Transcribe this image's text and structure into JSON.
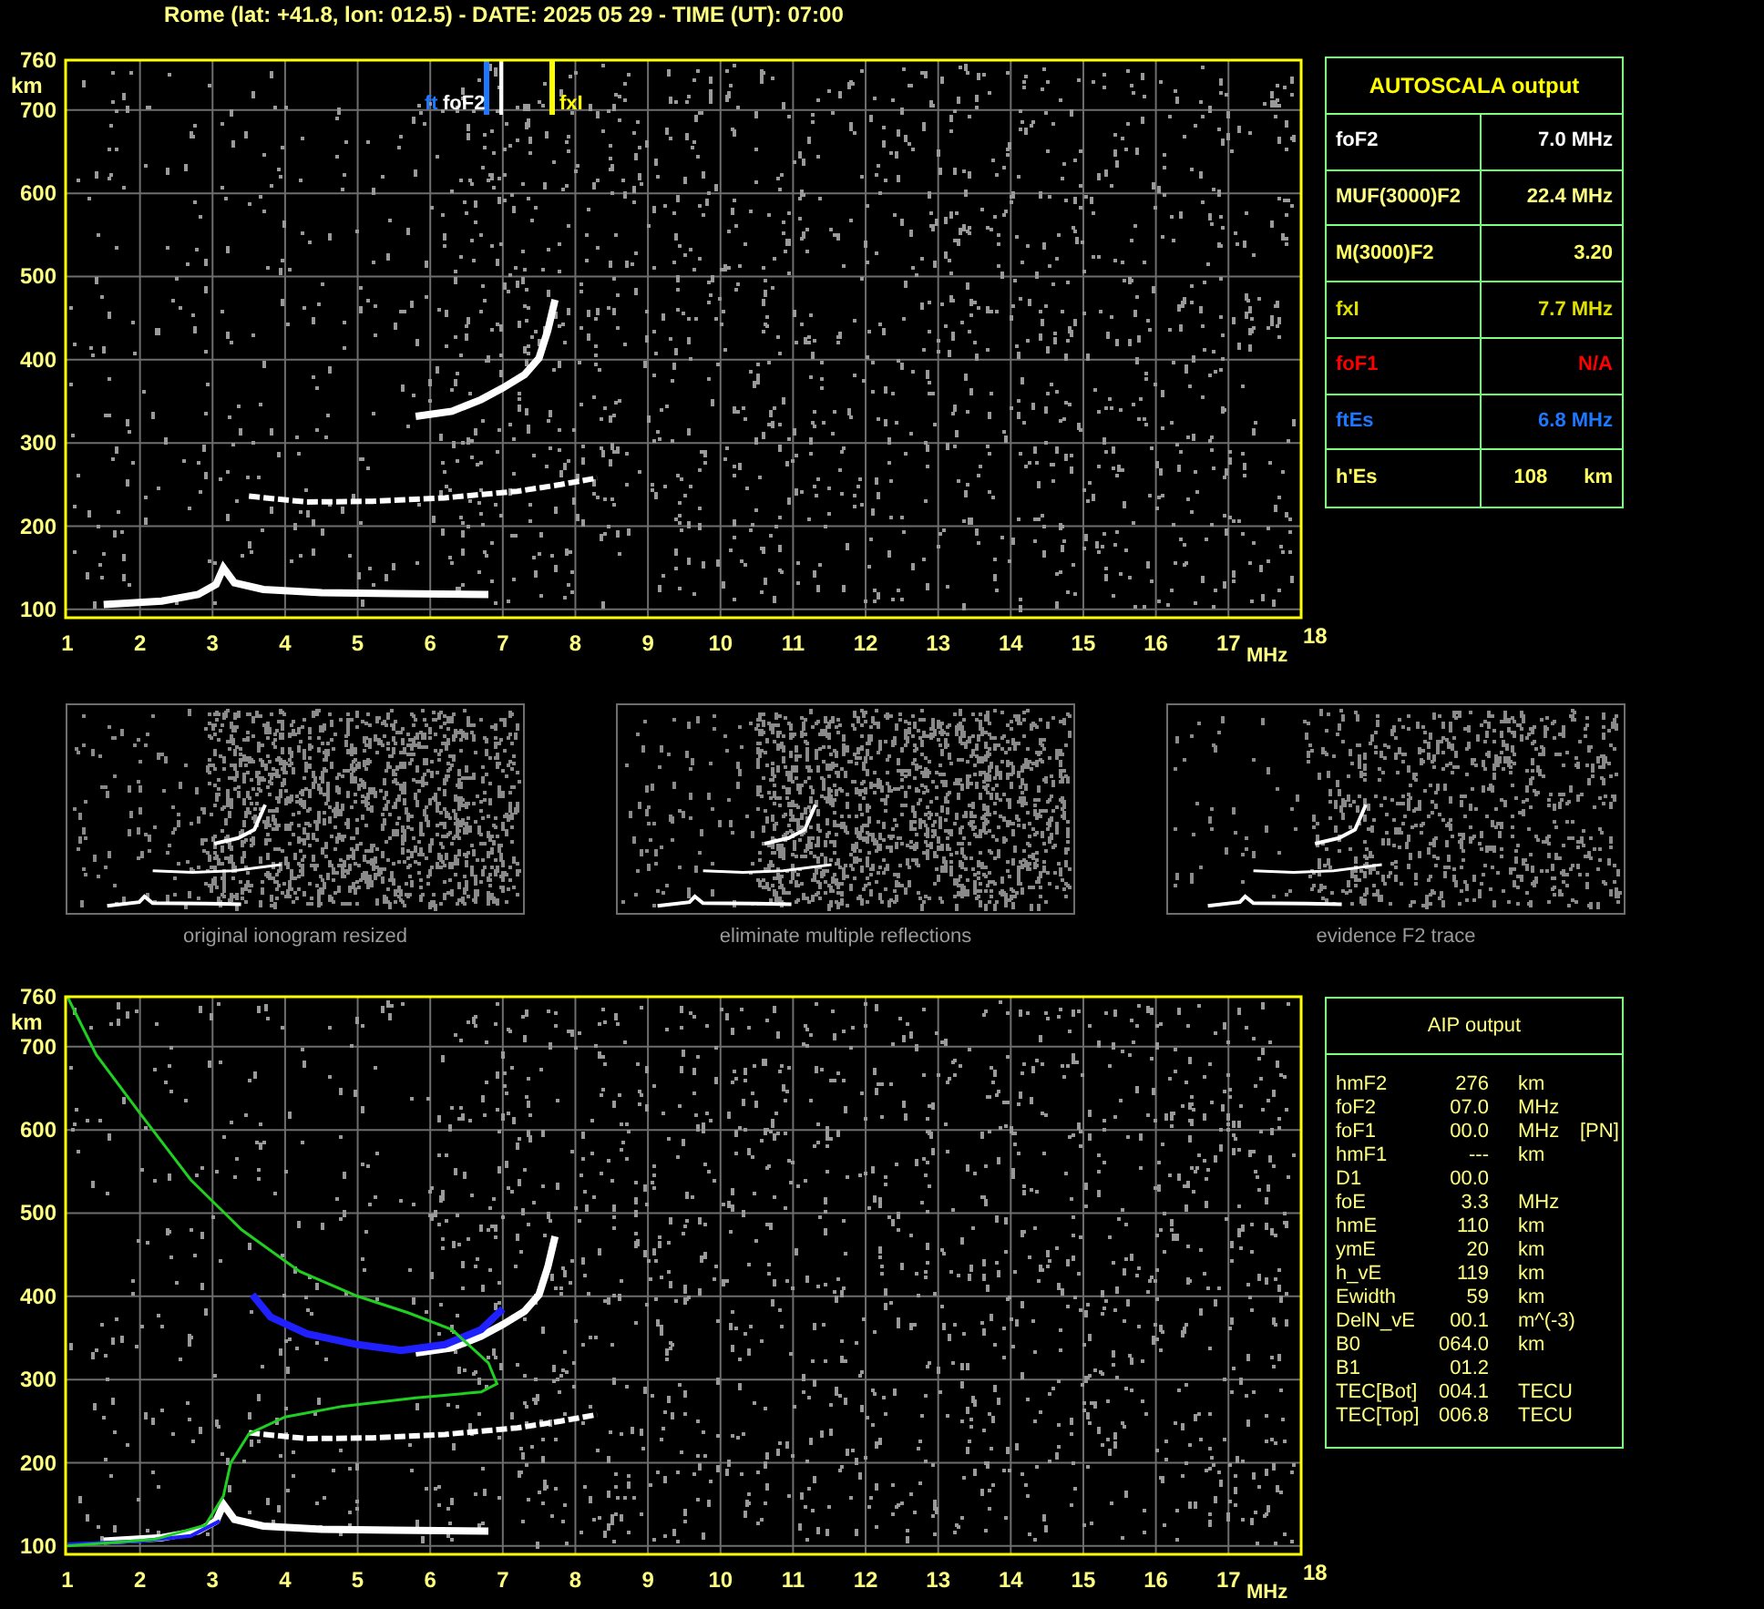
{
  "header": "Rome (lat: +41.8, lon: 012.5) - DATE: 2025 05 29 - TIME (UT): 07:00",
  "ionogram": {
    "y_unit": "km",
    "x_unit": "MHz",
    "yticks": [
      "760",
      "700",
      "600",
      "500",
      "400",
      "300",
      "200",
      "100"
    ],
    "xticks": [
      "1",
      "2",
      "3",
      "4",
      "5",
      "6",
      "7",
      "8",
      "9",
      "10",
      "11",
      "12",
      "13",
      "14",
      "15",
      "16",
      "17",
      "18"
    ],
    "markers": [
      {
        "label": "ft",
        "color": "#1e78ff"
      },
      {
        "label": "foF2",
        "color": "#ffffff"
      },
      {
        "label": "fxI",
        "color": "#ffff00"
      }
    ]
  },
  "autoscala": {
    "title": "AUTOSCALA output",
    "rows": [
      {
        "label": "foF2",
        "value": "7.0 MHz",
        "color": "#ffffff"
      },
      {
        "label": "MUF(3000)F2",
        "value": "22.4 MHz",
        "color": "#ffff80"
      },
      {
        "label": "M(3000)F2",
        "value": "3.20",
        "color": "#ffff60"
      },
      {
        "label": "fxI",
        "value": "7.7 MHz",
        "color": "#e0e000"
      },
      {
        "label": "foF1",
        "value": "N/A",
        "color": "#ff0000"
      },
      {
        "label": "ftEs",
        "value": "6.8 MHz",
        "color": "#1e78ff"
      },
      {
        "label": "h'Es",
        "value": "108",
        "unit": "km",
        "color": "#ffff60"
      }
    ]
  },
  "thumbnails": [
    {
      "caption": "original ionogram resized"
    },
    {
      "caption": "eliminate multiple reflections"
    },
    {
      "caption": "evidence F2 trace"
    }
  ],
  "profile_plot": {
    "y_unit": "km",
    "x_unit": "MHz",
    "yticks": [
      "760",
      "700",
      "600",
      "500",
      "400",
      "300",
      "200",
      "100"
    ],
    "xticks": [
      "1",
      "2",
      "3",
      "4",
      "5",
      "6",
      "7",
      "8",
      "9",
      "10",
      "11",
      "12",
      "13",
      "14",
      "15",
      "16",
      "17",
      "18"
    ]
  },
  "aip": {
    "title": "AIP output",
    "rows": [
      {
        "name": "hmF2",
        "value": "276",
        "unit": "km"
      },
      {
        "name": "foF2",
        "value": "07.0",
        "unit": "MHz"
      },
      {
        "name": "foF1",
        "value": "00.0",
        "unit": "MHz",
        "note": "[PN]"
      },
      {
        "name": "hmF1",
        "value": "---",
        "unit": "km"
      },
      {
        "name": "D1",
        "value": "00.0"
      },
      {
        "name": "foE",
        "value": "3.3",
        "unit": "MHz"
      },
      {
        "name": "hmE",
        "value": "110",
        "unit": "km"
      },
      {
        "name": "ymE",
        "value": "20",
        "unit": "km"
      },
      {
        "name": "h_vE",
        "value": "119",
        "unit": "km"
      },
      {
        "name": "Ewidth",
        "value": "59",
        "unit": "km"
      },
      {
        "name": "DelN_vE",
        "value": "00.1",
        "unit": "m^(-3)"
      },
      {
        "name": "B0",
        "value": "064.0",
        "unit": "km"
      },
      {
        "name": "B1",
        "value": "01.2"
      },
      {
        "name": "TEC[Bot]",
        "value": "004.1",
        "unit": "TECU"
      },
      {
        "name": "TEC[Top]",
        "value": "006.8",
        "unit": "TECU"
      }
    ]
  }
}
